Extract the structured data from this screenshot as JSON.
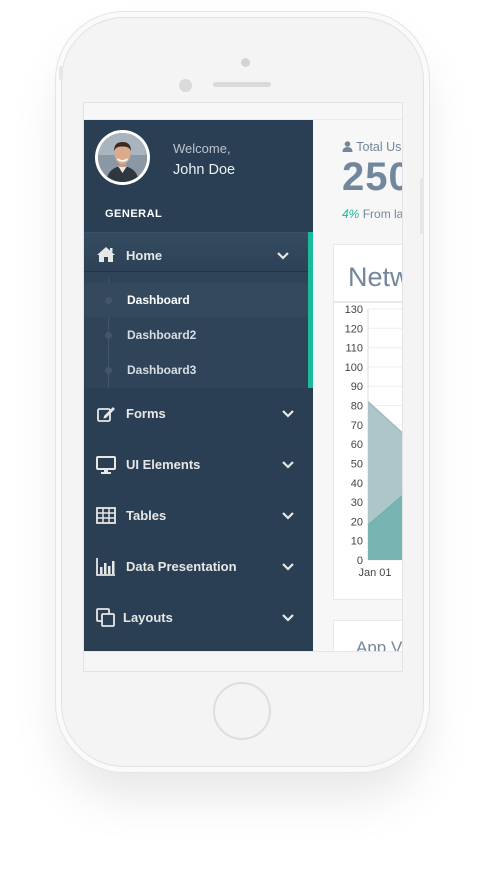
{
  "profile": {
    "welcome": "Welcome,",
    "name": "John Doe"
  },
  "sidebar": {
    "section_title": "GENERAL",
    "accent_color": "#1abb9c",
    "menu": [
      {
        "label": "Home",
        "icon": "home-icon",
        "expanded": true,
        "children": [
          "Dashboard",
          "Dashboard2",
          "Dashboard3"
        ],
        "current_child": "Dashboard"
      },
      {
        "label": "Forms",
        "icon": "edit-icon"
      },
      {
        "label": "UI Elements",
        "icon": "desktop-icon"
      },
      {
        "label": "Tables",
        "icon": "table-icon"
      },
      {
        "label": "Data Presentation",
        "icon": "bar-chart-icon"
      },
      {
        "label": "Layouts",
        "icon": "clone-icon"
      }
    ]
  },
  "stats": {
    "label": "Total Us",
    "value": "250",
    "change_pct": "4%",
    "change_text": "From la"
  },
  "network_panel": {
    "title": "Netw"
  },
  "chart_data": {
    "type": "area",
    "y_ticks": [
      0,
      10,
      20,
      30,
      40,
      50,
      60,
      70,
      80,
      90,
      100,
      110,
      120,
      130
    ],
    "ylim": [
      0,
      130
    ],
    "x_tick_label": "Jan 01",
    "series": [
      {
        "color": "#9fbcc1",
        "values": [
          82,
          65
        ]
      },
      {
        "color": "#6fb2ae",
        "values": [
          18,
          34
        ]
      }
    ],
    "grid": true
  },
  "app_panel": {
    "title": "App V"
  }
}
